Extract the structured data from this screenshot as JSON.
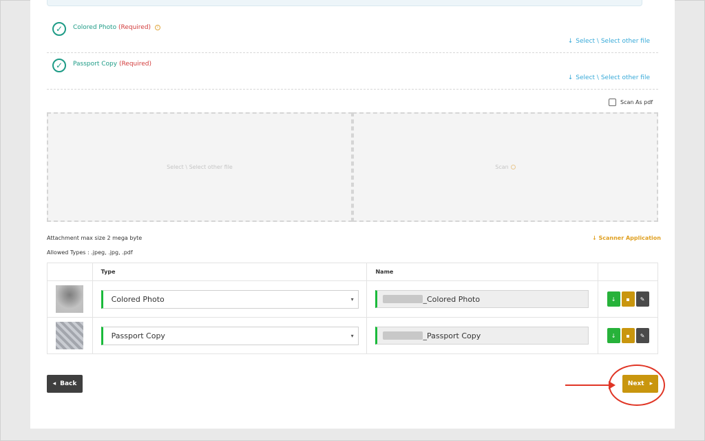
{
  "documents": [
    {
      "name": "Colored Photo",
      "required": "(Required)",
      "has_info": true,
      "select_link": "Select \\ Select other file"
    },
    {
      "name": "Passport Copy",
      "required": "(Required)",
      "has_info": false,
      "select_link": "Select \\ Select other file"
    }
  ],
  "scan_as_pdf": {
    "label": "Scan As pdf",
    "checked": false
  },
  "dropzones": {
    "select_label": "Select \\ Select other file",
    "scan_label": "Scan"
  },
  "attachment_info": {
    "max_size": "Attachment max size 2 mega byte",
    "allowed_types": "Allowed Types : .jpeg, .jpg, .pdf",
    "scanner_app": "Scanner Application"
  },
  "table": {
    "headers": {
      "thumb": "",
      "type": "Type",
      "name": "Name",
      "actions": ""
    },
    "rows": [
      {
        "type": "Colored Photo",
        "name_suffix": "_Colored Photo"
      },
      {
        "type": "Passport Copy",
        "name_suffix": "_Passport Copy"
      }
    ]
  },
  "nav": {
    "back": "Back",
    "next": "Next"
  },
  "icons": {
    "check": "check-circle-icon",
    "download": "download-icon",
    "delete": "trash-icon",
    "edit": "edit-icon",
    "info": "info-icon",
    "gear": "gear-icon"
  },
  "colors": {
    "teal": "#1d9b86",
    "required": "#d23b3b",
    "link": "#36a9d8",
    "gold": "#c9960e",
    "green": "#27b23a",
    "annotation": "#e03525"
  }
}
